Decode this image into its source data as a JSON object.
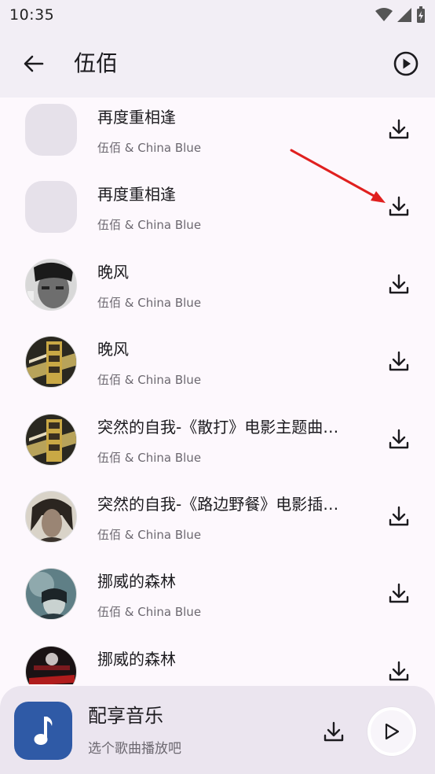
{
  "status_bar": {
    "time": "10:35"
  },
  "app_bar": {
    "title": "伍佰"
  },
  "songs": [
    {
      "title": "再度重相逢",
      "artist": "伍佰 & China Blue",
      "cover": "placeholder"
    },
    {
      "title": "再度重相逢",
      "artist": "伍佰 & China Blue",
      "cover": "placeholder"
    },
    {
      "title": "晚风",
      "artist": "伍佰 & China Blue",
      "cover": "face-bw"
    },
    {
      "title": "晚风",
      "artist": "伍佰 & China Blue",
      "cover": "gold-art"
    },
    {
      "title": "突然的自我-《散打》电影主题曲…",
      "artist": "伍佰 & China Blue",
      "cover": "gold-art"
    },
    {
      "title": "突然的自我-《路边野餐》电影插…",
      "artist": "伍佰 & China Blue",
      "cover": "face-dark"
    },
    {
      "title": "挪威的森林",
      "artist": "伍佰 & China Blue",
      "cover": "teal-art"
    },
    {
      "title": "挪威的森林",
      "artist": "",
      "cover": "concert-art"
    }
  ],
  "player": {
    "title": "配享音乐",
    "subtitle": "选个歌曲播放吧",
    "icon": "music-note-icon"
  },
  "colors": {
    "accent_cover": "#2f5aa6",
    "annotation_arrow": "#e0201f",
    "bar_bg": "#f2eef5",
    "page_bg": "#fdf8fd"
  }
}
